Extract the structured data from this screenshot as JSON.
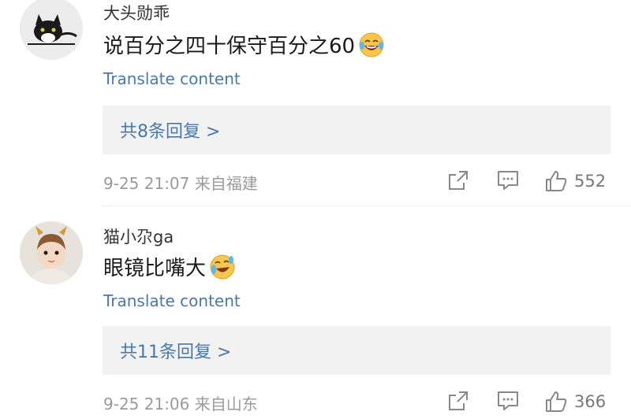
{
  "comments": [
    {
      "username": "大头勋乖",
      "text": "说百分之四十保守百分之60",
      "emoji": "laughing-tears-emoji",
      "translate_label": "Translate content",
      "replies_label": "共8条回复 >",
      "meta": "9-25 21:07 来自福建",
      "likes": "552",
      "avatar": "cat-avatar"
    },
    {
      "username": "猫小尕ga",
      "text": "眼镜比嘴大",
      "emoji": "crying-laughing-emoji",
      "translate_label": "Translate content",
      "replies_label": "共11条回复 >",
      "meta": "9-25 21:06 来自山东",
      "likes": "366",
      "avatar": "child-avatar"
    }
  ],
  "colors": {
    "link": "#4a78a8",
    "meta": "#9a9a9a",
    "reply_bg": "#f2f2f2",
    "icon": "#888888"
  }
}
